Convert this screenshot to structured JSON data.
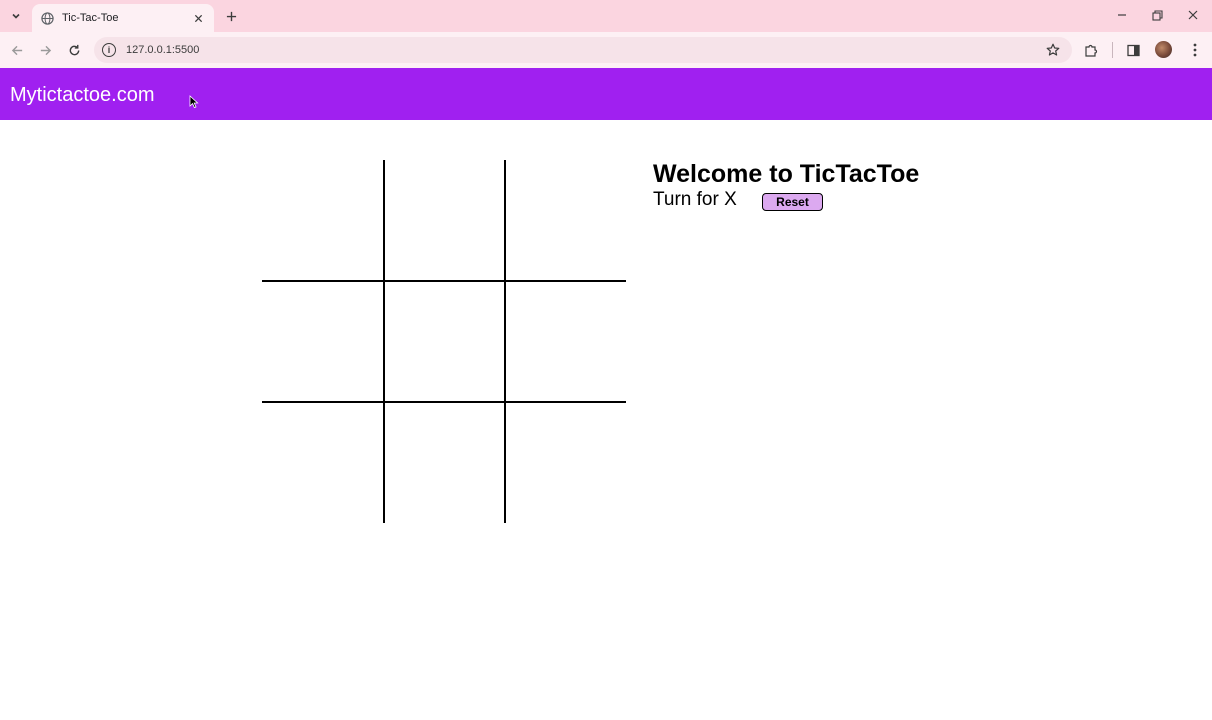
{
  "browser": {
    "tab_title": "Tic-Tac-Toe",
    "url": "127.0.0.1:5500",
    "tab_close_icon": "close-icon",
    "new_tab_icon": "plus-icon"
  },
  "page": {
    "brand": "Mytictactoe.com",
    "heading": "Welcome to TicTacToe",
    "turn_text": "Turn for X",
    "reset_label": "Reset"
  },
  "board": {
    "cells": [
      "",
      "",
      "",
      "",
      "",
      "",
      "",
      "",
      ""
    ]
  },
  "colors": {
    "navbar": "#a020f0",
    "reset_button": "#dca9f0",
    "chrome": "#fbd5e0"
  }
}
